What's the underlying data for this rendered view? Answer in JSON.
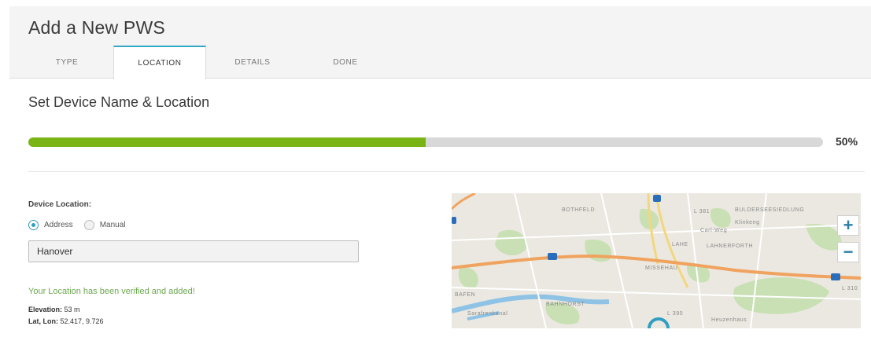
{
  "header": {
    "title": "Add a New PWS",
    "tabs": [
      {
        "label": "TYPE"
      },
      {
        "label": "LOCATION"
      },
      {
        "label": "DETAILS"
      },
      {
        "label": "DONE"
      }
    ],
    "active_tab": "LOCATION"
  },
  "section": {
    "title": "Set Device Name & Location"
  },
  "progress": {
    "percent": 50,
    "text": "50%",
    "fill_color": "#78b413"
  },
  "location": {
    "label": "Device Location:",
    "options": [
      {
        "label": "Address",
        "selected": true
      },
      {
        "label": "Manual",
        "selected": false
      }
    ],
    "address_value": "Hanover",
    "verified_message": "Your Location has been verified and added!",
    "elevation_label": "Elevation:",
    "elevation_value": "53 m",
    "latlon_label": "Lat, Lon:",
    "latlon_value": "52.417, 9.726"
  },
  "map": {
    "labels": [
      "BOTHFELD",
      "BULDERSEESIEDLUNG",
      "Klinkeng",
      "Carl-Weg",
      "LAHE",
      "LAHNERFORTH",
      "MISSEHAU",
      "BAFEN",
      "BAHNHORST",
      "Sarafrenkanal",
      "Heuzenhaus",
      "L 381",
      "L 390",
      "L 310"
    ],
    "zoom_in": "+",
    "zoom_out": "−"
  }
}
